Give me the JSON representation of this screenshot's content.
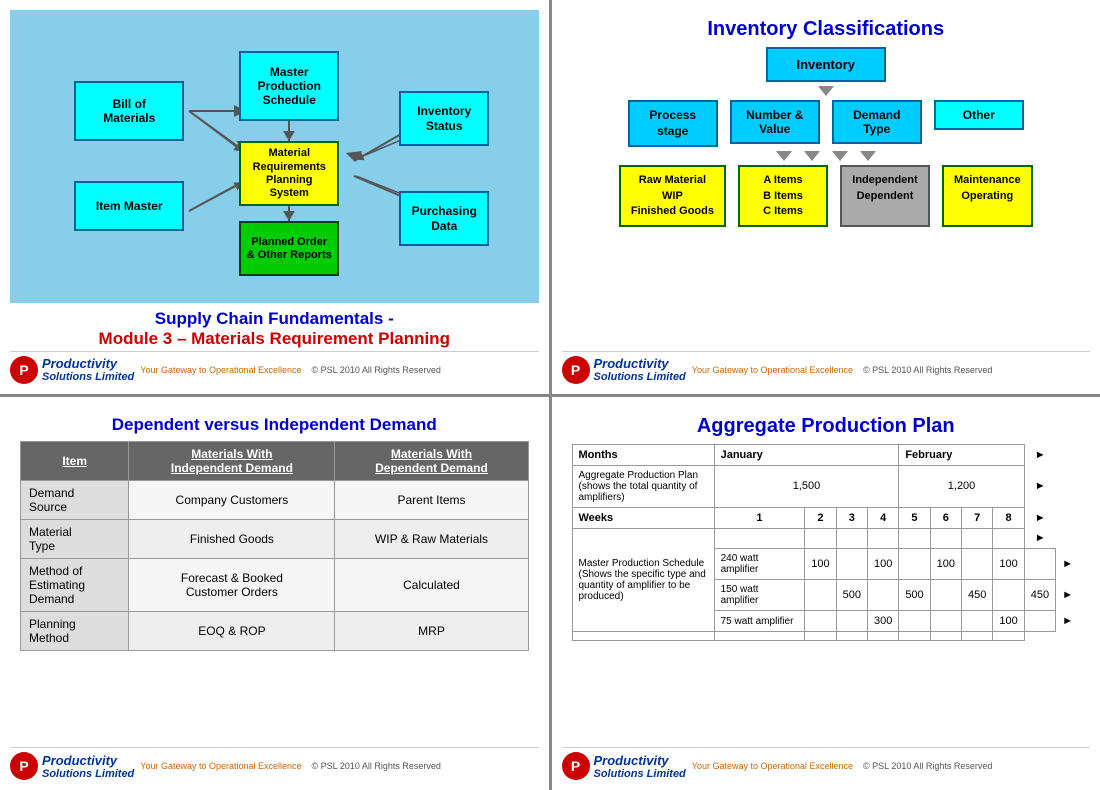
{
  "slide1": {
    "title_line1": "Supply Chain Fundamentals -",
    "title_line2": "Module 3 – Materials Requirement Planning",
    "footer_gateway": "Your Gateway to Operational Excellence",
    "footer_copy": "© PSL 2010 All Rights Reserved",
    "boxes": {
      "bill": "Bill of\nMaterials",
      "item": "Item Master",
      "mps": "Master\nProduction\nSchedule",
      "mrp": "Material\nRequirements\nPlanning System",
      "inv": "Inventory\nStatus",
      "purch": "Purchasing\nData",
      "planned": "Planned Order\n& Other Reports"
    }
  },
  "slide2": {
    "title": "Inventory Classifications",
    "top_box": "Inventory",
    "categories": [
      {
        "label": "Process\nstage",
        "color": "cyan",
        "children": [
          "Raw Material\nWIP\nFinished Goods"
        ]
      },
      {
        "label": "Number &\nValue",
        "color": "cyan",
        "children": [
          "A Items\nB Items\nC Items"
        ]
      },
      {
        "label": "Demand\nType",
        "color": "cyan",
        "children": [
          "Independent\nDependent"
        ]
      },
      {
        "label": "Other",
        "color": "cyan",
        "children": [
          "Maintenance\nOperating"
        ]
      }
    ],
    "footer_gateway": "Your Gateway to Operational Excellence",
    "footer_copy": "© PSL 2010 All Rights Reserved"
  },
  "slide3": {
    "title": "Dependent versus Independent Demand",
    "col1_header": "Materials With\nIndependent Demand",
    "col2_header": "Materials With\nDependent Demand",
    "rows": [
      {
        "label": "Demand\nSource",
        "col1": "Company Customers",
        "col2": "Parent Items"
      },
      {
        "label": "Material\nType",
        "col1": "Finished Goods",
        "col2": "WIP & Raw Materials"
      },
      {
        "label": "Method of\nEstimating\nDemand",
        "col1": "Forecast & Booked\nCustomer Orders",
        "col2": "Calculated"
      },
      {
        "label": "Planning\nMethod",
        "col1": "EOQ & ROP",
        "col2": "MRP"
      }
    ],
    "footer_gateway": "Your Gateway to Operational Excellence",
    "footer_copy": "© PSL 2010 All Rights Reserved"
  },
  "slide4": {
    "title": "Aggregate Production Plan",
    "header_months": [
      "Months",
      "January",
      "",
      "",
      "",
      "February",
      "",
      "",
      ""
    ],
    "header_weeks": [
      "",
      "1",
      "2",
      "3",
      "4",
      "5",
      "6",
      "7",
      "8"
    ],
    "app_row_label": "Aggregate Production Plan\n(shows the total quantity of amplifiers)",
    "app_jan": "1,500",
    "app_feb": "1,200",
    "mps_row_label": "Master Production Schedule\n(Shows the specific type and\nquantity of amplifier to be\nproduced)",
    "products": [
      {
        "name": "240 watt amplifier",
        "values": [
          "100",
          "",
          "100",
          "",
          "100",
          "",
          "100",
          ""
        ]
      },
      {
        "name": "150 watt amplifier",
        "values": [
          "",
          "500",
          "",
          "500",
          "",
          "450",
          "",
          "450"
        ]
      },
      {
        "name": "75 watt amplifier",
        "values": [
          "",
          "",
          "300",
          "",
          "",
          "",
          "100",
          ""
        ]
      }
    ],
    "footer_gateway": "Your Gateway to Operational Excellence",
    "footer_copy": "© PSL 2010 All Rights Reserved"
  }
}
